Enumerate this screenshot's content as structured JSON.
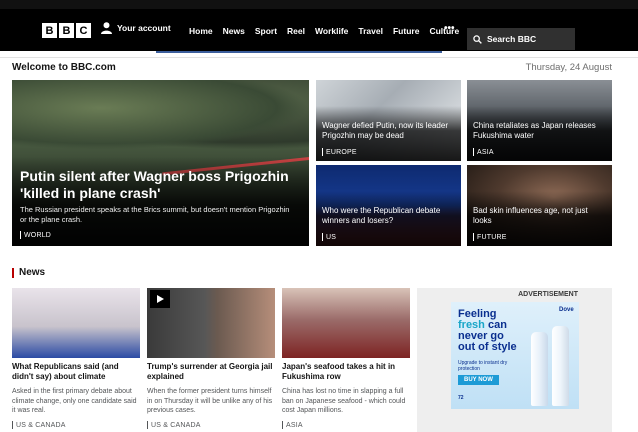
{
  "header": {
    "logo": [
      "B",
      "B",
      "C"
    ],
    "account_label": "Your account",
    "nav_items": [
      "Home",
      "News",
      "Sport",
      "Reel",
      "Worklife",
      "Travel",
      "Future",
      "Culture"
    ],
    "more_label": "•••",
    "search_label": "Search BBC"
  },
  "welcome": "Welcome to BBC.com",
  "date": "Thursday, 24 August",
  "hero": {
    "title": "Putin silent after Wagner boss Prigozhin 'killed in plane crash'",
    "description": "The Russian president speaks at the Brics summit, but doesn't mention Prigozhin or the plane crash.",
    "tag": "WORLD"
  },
  "tiles": [
    {
      "title": "Wagner defied Putin, now its leader Prigozhin may be dead",
      "tag": "EUROPE"
    },
    {
      "title": "China retaliates as Japan releases Fukushima water",
      "tag": "ASIA"
    },
    {
      "title": "Who were the Republican debate winners and losers?",
      "tag": "US"
    },
    {
      "title": "Bad skin influences age, not just looks",
      "tag": "FUTURE"
    }
  ],
  "news": {
    "label": "News",
    "items": [
      {
        "title": "What Republicans said (and didn't say) about climate",
        "description": "Asked in the first primary debate about climate change, only one candidate said it was real.",
        "tag": "US & CANADA"
      },
      {
        "title": "Trump's surrender at Georgia jail explained",
        "description": "When the former president turns himself in on Thursday it will be unlike any of his previous cases.",
        "tag": "US & CANADA"
      },
      {
        "title": "Japan's seafood takes a hit in Fukushima row",
        "description": "China has lost no time in slapping a full ban on Japanese seafood - which could cost Japan millions.",
        "tag": "ASIA"
      }
    ]
  },
  "ad": {
    "label": "ADVERTISEMENT",
    "headline_1": "Feeling",
    "headline_2": "fresh",
    "headline_3": "can",
    "headline_4": "never go",
    "headline_5": "out of style",
    "sub": "Upgrade to instant dry protection",
    "buy": "BUY NOW",
    "hours": "72",
    "brand": "Dove"
  },
  "colors": {
    "nav_bg": "#000000",
    "news_accent": "#b80000",
    "nav_underline": "#3c5e9c"
  }
}
